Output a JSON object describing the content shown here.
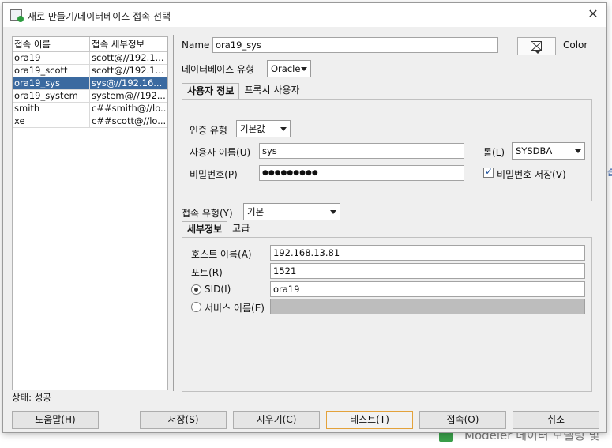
{
  "dialog": {
    "title": "새로 만들기/데이터베이스 접속 선택"
  },
  "connections": {
    "headers": [
      "접속 이름",
      "접속 세부정보"
    ],
    "rows": [
      {
        "name": "ora19",
        "details": "scott@//192.1..."
      },
      {
        "name": "ora19_scott",
        "details": "scott@//192.1..."
      },
      {
        "name": "ora19_sys",
        "details": "sys@//192.16...",
        "selected": true
      },
      {
        "name": "ora19_system",
        "details": "system@//192..."
      },
      {
        "name": "smith",
        "details": "c##smith@//lo..."
      },
      {
        "name": "xe",
        "details": "c##scott@//lo..."
      }
    ]
  },
  "status": "상태: 성공",
  "form": {
    "name_label": "Name",
    "name_value": "ora19_sys",
    "color_label": "Color",
    "db_type_label": "데이터베이스 유형",
    "db_type_value": "Oracle",
    "user_tabs": [
      "사용자 정보",
      "프록시 사용자"
    ],
    "auth_type_label": "인증 유형",
    "auth_type_value": "기본값",
    "username_label": "사용자 이름(U)",
    "username_value": "sys",
    "role_label": "롤(L)",
    "role_value": "SYSDBA",
    "password_label": "비밀번호(P)",
    "password_value": "●●●●●●●●●",
    "save_password_label": "비밀번호 저장(V)",
    "save_password_checked": true,
    "conn_type_label": "접속 유형(Y)",
    "conn_type_value": "기본",
    "detail_tabs": [
      "세부정보",
      "고급"
    ],
    "host_label": "호스트 이름(A)",
    "host_value": "192.168.13.81",
    "port_label": "포트(R)",
    "port_value": "1521",
    "sid_label": "SID(I)",
    "sid_value": "ora19",
    "sid_selected": true,
    "service_label": "서비스 이름(E)",
    "service_value": ""
  },
  "buttons": {
    "help": "도움말(H)",
    "save": "저장(S)",
    "clear": "지우기(C)",
    "test": "테스트(T)",
    "connect": "접속(O)",
    "cancel": "취소"
  },
  "background": {
    "bottom_text": "Modeler  데이터 모델링 및",
    "right_fragment": "습"
  }
}
